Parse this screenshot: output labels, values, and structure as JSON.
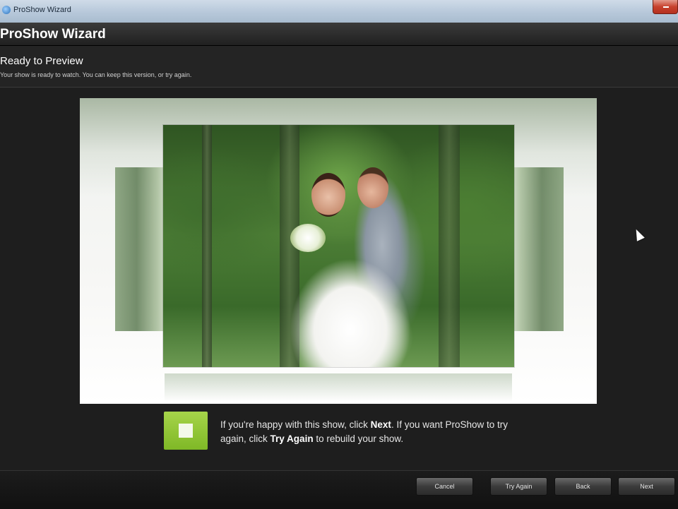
{
  "window": {
    "title": "ProShow Wizard"
  },
  "wizard": {
    "title": "ProShow Wizard"
  },
  "step": {
    "title": "Ready to Preview",
    "subtitle": "Your show is ready to watch. You can keep this version, or try again."
  },
  "help": {
    "part1": "If you're happy with this show, click ",
    "next_word": "Next",
    "part2": ". If you want ProShow to try again, click ",
    "try_word": "Try Again",
    "part3": " to rebuild your show."
  },
  "buttons": {
    "cancel": "Cancel",
    "try_again": "Try Again",
    "back": "Back",
    "next": "Next"
  },
  "colors": {
    "play_button": "#8cc63f",
    "background": "#1e1e1e"
  },
  "icons": {
    "app": "app-icon",
    "close": "close-icon",
    "play": "play-icon",
    "cursor": "mouse-cursor"
  }
}
